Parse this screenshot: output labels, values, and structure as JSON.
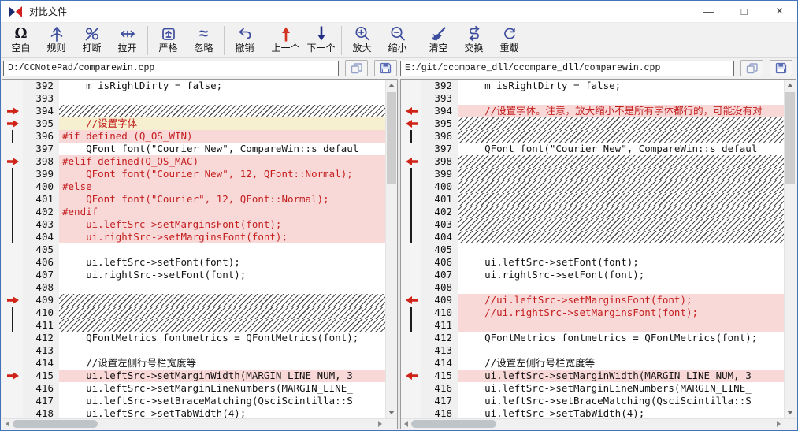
{
  "window": {
    "title": "对比文件",
    "app_icon": "compare-triangles-icon",
    "controls": [
      {
        "name": "minimize",
        "glyph": "—"
      },
      {
        "name": "maximize",
        "glyph": "□"
      },
      {
        "name": "close",
        "glyph": "×"
      }
    ]
  },
  "colors": {
    "window_border": "#4373b8",
    "icon_blue": "#3d4d9e",
    "prev_arrow_red": "#d3331e",
    "next_arrow_blue": "#242e86",
    "marker_arrow_red": "#cf2318",
    "diff_pink_bg": "#f9d8d8",
    "diff_yellow_bg": "#f6efd0",
    "diff_red_text": "#c41f1f"
  },
  "toolbar": {
    "groups": [
      {
        "items": [
          {
            "id": "blank",
            "label": "空白",
            "icon": "omega-icon"
          },
          {
            "id": "rules",
            "label": "规则",
            "icon": "rule-arrow-icon"
          },
          {
            "id": "break",
            "label": "打断",
            "icon": "break-loops-icon"
          },
          {
            "id": "stretch",
            "label": "拉开",
            "icon": "stretch-arrows-icon"
          }
        ]
      },
      {
        "items": [
          {
            "id": "strict",
            "label": "严格",
            "icon": "strict-box-icon"
          },
          {
            "id": "ignore",
            "label": "忽略",
            "icon": "approx-icon"
          }
        ]
      },
      {
        "items": [
          {
            "id": "undo",
            "label": "撤销",
            "icon": "undo-arrow-icon"
          }
        ]
      },
      {
        "items": [
          {
            "id": "prev",
            "label": "上一个",
            "icon": "up-arrow-icon"
          },
          {
            "id": "next",
            "label": "下一个",
            "icon": "down-arrow-icon"
          }
        ]
      },
      {
        "items": [
          {
            "id": "zoom-in",
            "label": "放大",
            "icon": "zoom-in-icon"
          },
          {
            "id": "zoom-out",
            "label": "缩小",
            "icon": "zoom-out-icon"
          }
        ]
      },
      {
        "items": [
          {
            "id": "clear",
            "label": "清空",
            "icon": "brush-icon"
          },
          {
            "id": "swap",
            "label": "交换",
            "icon": "swap-s-icon"
          },
          {
            "id": "reload",
            "label": "重载",
            "icon": "reload-circle-icon"
          }
        ]
      }
    ]
  },
  "left_pane": {
    "path": "D:/CCNotePad/comparewin.cpp",
    "buttons": [
      {
        "name": "copy",
        "icon": "copy-doc-icon"
      },
      {
        "name": "save",
        "icon": "save-floppy-icon"
      }
    ],
    "lines": [
      {
        "n": "392",
        "t": "    m_isRightDirty = false;",
        "bg": "white",
        "fg": "black",
        "m": "none"
      },
      {
        "n": "393",
        "t": "",
        "bg": "white",
        "fg": "black",
        "m": "none"
      },
      {
        "n": "394",
        "t": "",
        "bg": "hatch",
        "fg": "black",
        "m": "arrow"
      },
      {
        "n": "395",
        "t": "    //设置字体",
        "bg": "yellow",
        "fg": "red",
        "m": "arrow"
      },
      {
        "n": "396",
        "t": "#if defined (Q_OS_WIN)",
        "bg": "pink",
        "fg": "red",
        "m": "bar"
      },
      {
        "n": "397",
        "t": "    QFont font(\"Courier New\", CompareWin::s_defaul",
        "bg": "white",
        "fg": "black",
        "m": "none"
      },
      {
        "n": "398",
        "t": "#elif defined(Q_OS_MAC)",
        "bg": "pink",
        "fg": "red",
        "m": "arrow"
      },
      {
        "n": "399",
        "t": "    QFont font(\"Courier New\", 12, QFont::Normal);",
        "bg": "pink",
        "fg": "red",
        "m": "bar"
      },
      {
        "n": "400",
        "t": "#else",
        "bg": "pink",
        "fg": "red",
        "m": "bar"
      },
      {
        "n": "401",
        "t": "    QFont font(\"Courier\", 12, QFont::Normal);",
        "bg": "pink",
        "fg": "red",
        "m": "bar"
      },
      {
        "n": "402",
        "t": "#endif",
        "bg": "pink",
        "fg": "red",
        "m": "bar"
      },
      {
        "n": "403",
        "t": "    ui.leftSrc->setMarginsFont(font);",
        "bg": "pink",
        "fg": "red",
        "m": "bar"
      },
      {
        "n": "404",
        "t": "    ui.rightSrc->setMarginsFont(font);",
        "bg": "pink",
        "fg": "red",
        "m": "bar"
      },
      {
        "n": "405",
        "t": "",
        "bg": "white",
        "fg": "black",
        "m": "none"
      },
      {
        "n": "406",
        "t": "    ui.leftSrc->setFont(font);",
        "bg": "white",
        "fg": "black",
        "m": "none"
      },
      {
        "n": "407",
        "t": "    ui.rightSrc->setFont(font);",
        "bg": "white",
        "fg": "black",
        "m": "none"
      },
      {
        "n": "408",
        "t": "",
        "bg": "white",
        "fg": "black",
        "m": "none"
      },
      {
        "n": "409",
        "t": "",
        "bg": "hatch",
        "fg": "black",
        "m": "arrow"
      },
      {
        "n": "410",
        "t": "",
        "bg": "hatch",
        "fg": "black",
        "m": "bar"
      },
      {
        "n": "411",
        "t": "",
        "bg": "hatch",
        "fg": "black",
        "m": "bar"
      },
      {
        "n": "412",
        "t": "    QFontMetrics fontmetrics = QFontMetrics(font);",
        "bg": "white",
        "fg": "black",
        "m": "none"
      },
      {
        "n": "413",
        "t": "",
        "bg": "white",
        "fg": "black",
        "m": "none"
      },
      {
        "n": "414",
        "t": "    //设置左侧行号栏宽度等",
        "bg": "white",
        "fg": "black",
        "m": "none"
      },
      {
        "n": "415",
        "t": "    ui.leftSrc->setMarginWidth(MARGIN_LINE_NUM, 3",
        "bg": "pink",
        "fg": "black",
        "m": "arrow"
      },
      {
        "n": "416",
        "t": "    ui.leftSrc->setMarginLineNumbers(MARGIN_LINE_",
        "bg": "white",
        "fg": "black",
        "m": "none"
      },
      {
        "n": "417",
        "t": "    ui.leftSrc->setBraceMatching(QsciScintilla::S",
        "bg": "white",
        "fg": "black",
        "m": "none"
      },
      {
        "n": "418",
        "t": "    ui.leftSrc->setTabWidth(4);",
        "bg": "white",
        "fg": "black",
        "m": "none"
      }
    ]
  },
  "right_pane": {
    "path": "E:/git/ccompare_dll/ccompare_dll/comparewin.cpp",
    "buttons": [
      {
        "name": "copy",
        "icon": "copy-doc-icon"
      },
      {
        "name": "save",
        "icon": "save-floppy-icon"
      }
    ],
    "lines": [
      {
        "n": "392",
        "t": "    m_isRightDirty = false;",
        "bg": "white",
        "fg": "black",
        "m": "none"
      },
      {
        "n": "393",
        "t": "",
        "bg": "white",
        "fg": "black",
        "m": "none"
      },
      {
        "n": "394",
        "t": "    //设置字体。注意，放大缩小不是所有字体都行的，可能没有对",
        "bg": "pink",
        "fg": "red",
        "m": "arrow"
      },
      {
        "n": "395",
        "t": "",
        "bg": "hatch",
        "fg": "black",
        "m": "arrow"
      },
      {
        "n": "396",
        "t": "",
        "bg": "hatch",
        "fg": "black",
        "m": "bar"
      },
      {
        "n": "397",
        "t": "    QFont font(\"Courier New\", CompareWin::s_defaul",
        "bg": "white",
        "fg": "black",
        "m": "none"
      },
      {
        "n": "398",
        "t": "",
        "bg": "hatch",
        "fg": "black",
        "m": "arrow"
      },
      {
        "n": "399",
        "t": "",
        "bg": "hatch",
        "fg": "black",
        "m": "bar"
      },
      {
        "n": "400",
        "t": "",
        "bg": "hatch",
        "fg": "black",
        "m": "bar"
      },
      {
        "n": "401",
        "t": "",
        "bg": "hatch",
        "fg": "black",
        "m": "bar"
      },
      {
        "n": "402",
        "t": "",
        "bg": "hatch",
        "fg": "black",
        "m": "bar"
      },
      {
        "n": "403",
        "t": "",
        "bg": "hatch",
        "fg": "black",
        "m": "bar"
      },
      {
        "n": "404",
        "t": "",
        "bg": "hatch",
        "fg": "black",
        "m": "bar"
      },
      {
        "n": "405",
        "t": "",
        "bg": "white",
        "fg": "black",
        "m": "none"
      },
      {
        "n": "406",
        "t": "    ui.leftSrc->setFont(font);",
        "bg": "white",
        "fg": "black",
        "m": "none"
      },
      {
        "n": "407",
        "t": "    ui.rightSrc->setFont(font);",
        "bg": "white",
        "fg": "black",
        "m": "none"
      },
      {
        "n": "408",
        "t": "",
        "bg": "white",
        "fg": "black",
        "m": "none"
      },
      {
        "n": "409",
        "t": "    //ui.leftSrc->setMarginsFont(font);",
        "bg": "pink",
        "fg": "red",
        "m": "arrow"
      },
      {
        "n": "410",
        "t": "    //ui.rightSrc->setMarginsFont(font);",
        "bg": "pink",
        "fg": "red",
        "m": "bar"
      },
      {
        "n": "411",
        "t": "",
        "bg": "pink",
        "fg": "red",
        "m": "bar"
      },
      {
        "n": "412",
        "t": "    QFontMetrics fontmetrics = QFontMetrics(font);",
        "bg": "white",
        "fg": "black",
        "m": "none"
      },
      {
        "n": "413",
        "t": "",
        "bg": "white",
        "fg": "black",
        "m": "none"
      },
      {
        "n": "414",
        "t": "    //设置左侧行号栏宽度等",
        "bg": "white",
        "fg": "black",
        "m": "none"
      },
      {
        "n": "415",
        "t": "    ui.leftSrc->setMarginWidth(MARGIN_LINE_NUM, 3",
        "bg": "pink",
        "fg": "black",
        "m": "arrow"
      },
      {
        "n": "416",
        "t": "    ui.leftSrc->setMarginLineNumbers(MARGIN_LINE_",
        "bg": "white",
        "fg": "black",
        "m": "none"
      },
      {
        "n": "417",
        "t": "    ui.leftSrc->setBraceMatching(QsciScintilla::S",
        "bg": "white",
        "fg": "black",
        "m": "none"
      },
      {
        "n": "418",
        "t": "    ui.leftSrc->setTabWidth(4);",
        "bg": "white",
        "fg": "black",
        "m": "none"
      }
    ]
  }
}
